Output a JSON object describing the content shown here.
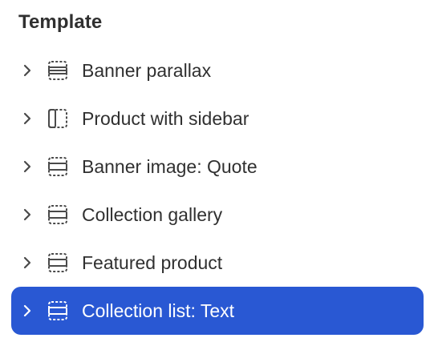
{
  "panel": {
    "heading": "Template",
    "items": [
      {
        "label": "Banner parallax",
        "icon": "section-horizontal-icon",
        "selected": false
      },
      {
        "label": "Product with sidebar",
        "icon": "section-sidebar-icon",
        "selected": false
      },
      {
        "label": "Banner image: Quote",
        "icon": "section-horizontal-icon",
        "selected": false
      },
      {
        "label": "Collection gallery",
        "icon": "section-horizontal-icon",
        "selected": false
      },
      {
        "label": "Featured product",
        "icon": "section-horizontal-icon",
        "selected": false
      },
      {
        "label": "Collection list: Text",
        "icon": "section-horizontal-icon",
        "selected": true
      }
    ]
  },
  "colors": {
    "text": "#303030",
    "icon": "#4a4a4a",
    "selected_bg": "#2958d3",
    "selected_text": "#ffffff"
  }
}
